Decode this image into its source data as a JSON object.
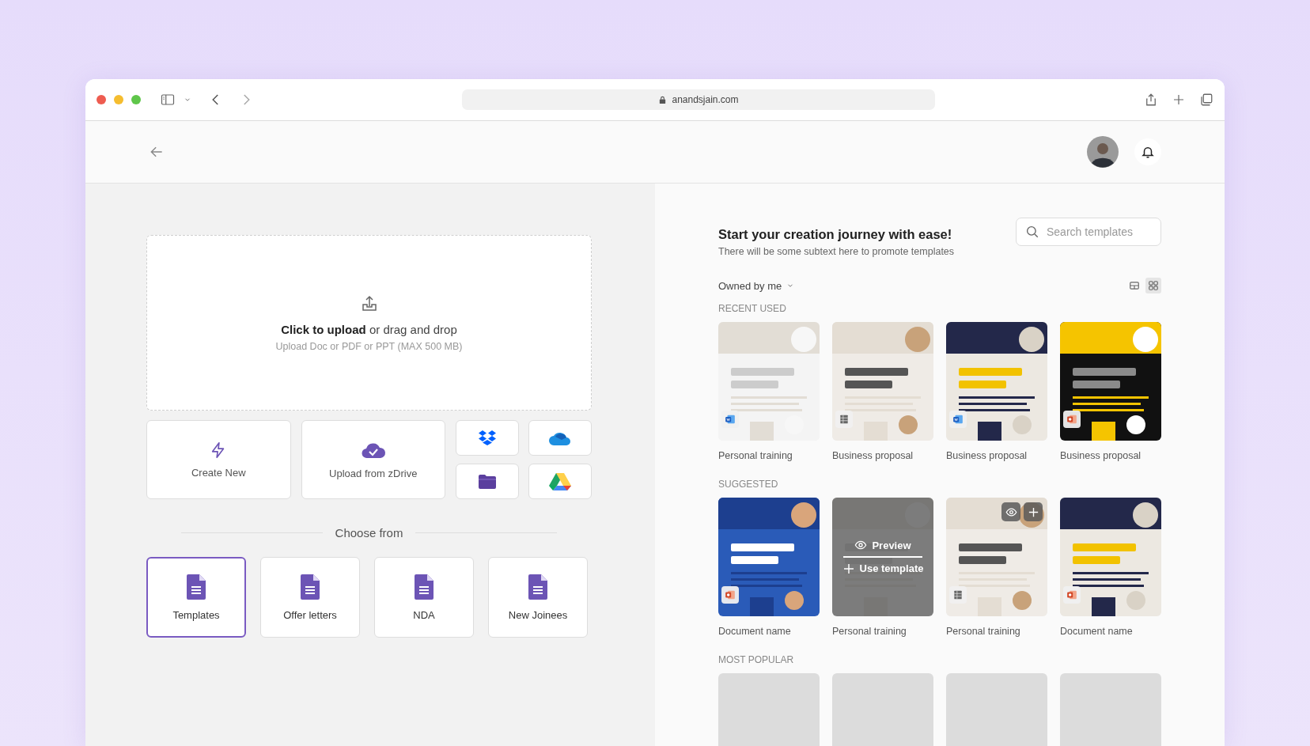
{
  "browser": {
    "url": "anandsjain.com"
  },
  "upload": {
    "title": "**Click to upload** or drag and drop",
    "hint": "Upload Doc or PDF or PPT (MAX 500 MB)"
  },
  "sources": [
    {
      "kind": "create",
      "label": "Create New"
    },
    {
      "kind": "zdrive",
      "label": "Upload from zDrive"
    },
    {
      "kind": "dropbox"
    },
    {
      "kind": "onedrive"
    },
    {
      "kind": "folder"
    },
    {
      "kind": "gdrive"
    }
  ],
  "choose_from": {
    "heading": "Choose from",
    "categories": [
      {
        "label": "Templates",
        "selected": true
      },
      {
        "label": "Offer letters",
        "selected": false
      },
      {
        "label": "NDA",
        "selected": false
      },
      {
        "label": "New Joinees",
        "selected": false
      }
    ]
  },
  "templates": {
    "title": "Start your creation journey with ease!",
    "subtitle": "There will be some subtext here to promote templates",
    "search": {
      "placeholder": "Search templates"
    },
    "filter": "Owned by me",
    "view_modes": [
      {
        "kind": "table",
        "selected": false
      },
      {
        "kind": "grid",
        "selected": true
      }
    ],
    "sections": [
      {
        "heading": "RECENT USED",
        "items": [
          {
            "kind": "picture",
            "name": "Personal training",
            "badge": {
              "kind": "word"
            }
          },
          {
            "kind": "picture",
            "name": "Business proposal",
            "badge": {
              "kind": "sheet"
            }
          },
          {
            "kind": "picture",
            "name": "Business proposal",
            "badge": {
              "kind": "word"
            }
          },
          {
            "kind": "picture",
            "name": "Business proposal",
            "badge": {
              "kind": "slides"
            }
          }
        ]
      },
      {
        "heading": "SUGGESTED",
        "items": [
          {
            "kind": "picture",
            "name": "Document name",
            "badge": {
              "kind": "slides"
            }
          },
          {
            "kind": "picture",
            "name": "Personal training",
            "hovered": true,
            "actions": [
              "Preview",
              "Use template"
            ]
          },
          {
            "kind": "picture",
            "name": "Personal training",
            "badge": {
              "kind": "sheet"
            },
            "quick_actions": true
          },
          {
            "kind": "picture",
            "name": "Document name",
            "badge": {
              "kind": "slides"
            }
          }
        ]
      },
      {
        "heading": "MOST POPULAR",
        "items": [
          {
            "kind": "placeholder"
          },
          {
            "kind": "placeholder"
          },
          {
            "kind": "placeholder"
          },
          {
            "kind": "placeholder"
          }
        ]
      }
    ]
  }
}
